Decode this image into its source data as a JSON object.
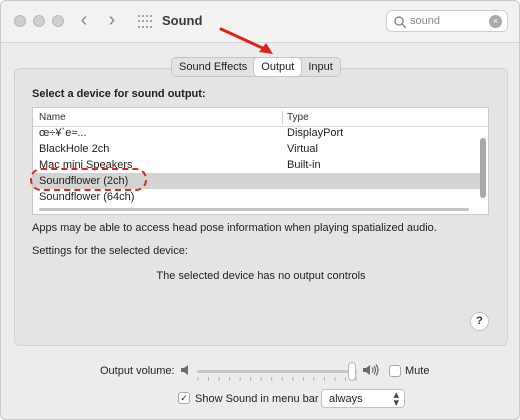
{
  "window": {
    "title": "Sound",
    "nav_back": "‹",
    "nav_forward": "›"
  },
  "search": {
    "placeholder": "sound",
    "value": "sound",
    "clear_glyph": "×"
  },
  "tabs": [
    {
      "label": "Sound Effects",
      "selected": false
    },
    {
      "label": "Output",
      "selected": true
    },
    {
      "label": "Input",
      "selected": false
    }
  ],
  "output": {
    "heading": "Select a device for sound output:",
    "columns": [
      "Name",
      "Type"
    ],
    "devices": [
      {
        "name": "œ÷¥`e≈...",
        "type": "DisplayPort",
        "selected": false
      },
      {
        "name": "BlackHole 2ch",
        "type": "Virtual",
        "selected": false
      },
      {
        "name": "Mac mini Speakers",
        "type": "Built-in",
        "selected": false
      },
      {
        "name": "Soundflower (2ch)",
        "type": "",
        "selected": true
      },
      {
        "name": "Soundflower (64ch)",
        "type": "",
        "selected": false
      }
    ],
    "spatial_note": "Apps may be able to access head pose information when playing spatialized audio.",
    "settings_label": "Settings for the selected device:",
    "no_controls": "The selected device has no output controls",
    "help": "?"
  },
  "bottom": {
    "volume_label": "Output volume:",
    "volume_level": 0.97,
    "mute_label": "Mute",
    "mute_checked": false,
    "menubar_label": "Show Sound in menu bar",
    "menubar_checked": true,
    "menubar_option": "always"
  },
  "annotation": {
    "color": "#e0241b",
    "highlight": "Soundflower (2ch)"
  }
}
